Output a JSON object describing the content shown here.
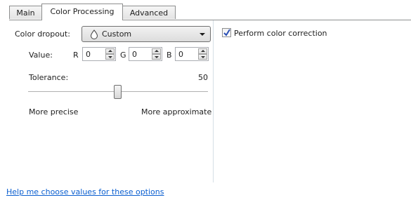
{
  "tabs": [
    {
      "label": "Main",
      "active": false
    },
    {
      "label": "Color Processing",
      "active": true
    },
    {
      "label": "Advanced",
      "active": false
    }
  ],
  "color_dropout": {
    "label": "Color dropout:",
    "selected": "Custom",
    "icon": "droplet-icon"
  },
  "value_row": {
    "label": "Value:",
    "r_label": "R",
    "r_value": "0",
    "g_label": "G",
    "g_value": "0",
    "b_label": "B",
    "b_value": "0"
  },
  "tolerance": {
    "label": "Tolerance:",
    "value": "50",
    "level_fraction": 0.5,
    "min_label": "More precise",
    "max_label": "More approximate"
  },
  "color_correction": {
    "label": "Perform color correction",
    "checked": true
  },
  "help_link": "Help me choose values for these options",
  "colors": {
    "link": "#0b5fd0",
    "check": "#2a4fb5"
  }
}
